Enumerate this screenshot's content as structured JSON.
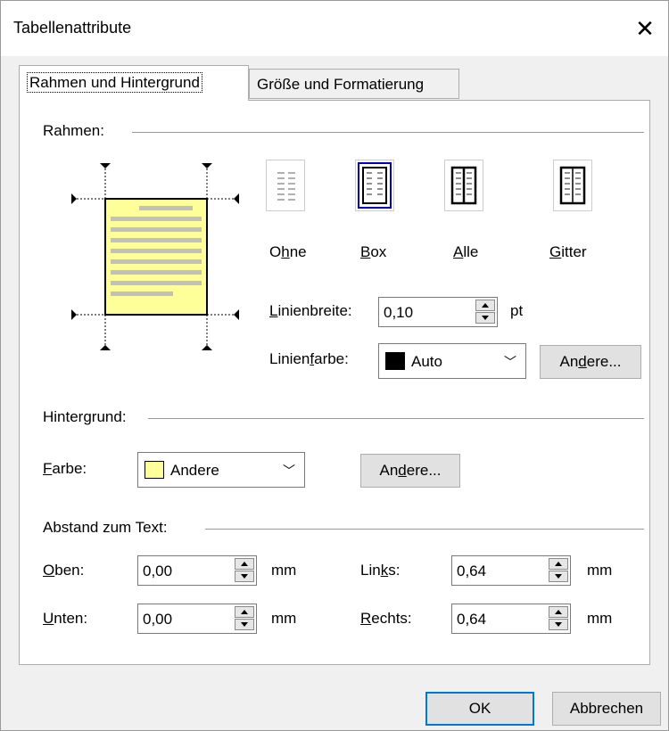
{
  "window": {
    "title": "Tabellenattribute",
    "close_glyph": "✕"
  },
  "tabs": [
    {
      "label": "Rahmen und Hintergrund",
      "selected": true
    },
    {
      "label": "Größe und Formatierung",
      "selected": false
    }
  ],
  "border_section": {
    "group_label": "Rahmen:",
    "presets": [
      {
        "label_pre": "O",
        "label_u": "h",
        "label_post": "ne",
        "icon": "border-none-icon"
      },
      {
        "label_pre": "",
        "label_u": "B",
        "label_post": "ox",
        "icon": "border-box-icon",
        "selected": true
      },
      {
        "label_pre": "",
        "label_u": "A",
        "label_post": "lle",
        "icon": "border-all-icon"
      },
      {
        "label_pre": "",
        "label_u": "G",
        "label_post": "itter",
        "icon": "border-grid-icon"
      }
    ],
    "line_width": {
      "label_u": "L",
      "label_rest": "inienbreite:",
      "value": "0,10",
      "unit": "pt"
    },
    "line_color": {
      "label_pre": "Linien",
      "label_u": "f",
      "label_post": "arbe:",
      "value": "Auto",
      "swatch": "#000000"
    },
    "other_button": {
      "pre": "An",
      "u": "d",
      "post": "ere..."
    },
    "preview_fill": "#ffff99"
  },
  "background_section": {
    "group_label": "Hintergrund:",
    "color_label_u": "F",
    "color_label_rest": "arbe:",
    "color_value": "Andere",
    "swatch": "#ffff99",
    "other_button": {
      "pre": "An",
      "u": "d",
      "post": "ere..."
    }
  },
  "spacing_section": {
    "group_label": "Abstand zum Text:",
    "top": {
      "label_u": "O",
      "label_rest": "ben:",
      "value": "0,00",
      "unit": "mm"
    },
    "bottom": {
      "label_u": "U",
      "label_rest": "nten:",
      "value": "0,00",
      "unit": "mm"
    },
    "left": {
      "label_pre": "Lin",
      "label_u": "k",
      "label_post": "s:",
      "value": "0,64",
      "unit": "mm"
    },
    "right": {
      "label_u": "R",
      "label_rest": "echts:",
      "value": "0,64",
      "unit": "mm"
    }
  },
  "footer": {
    "ok": "OK",
    "cancel": "Abbrechen"
  }
}
